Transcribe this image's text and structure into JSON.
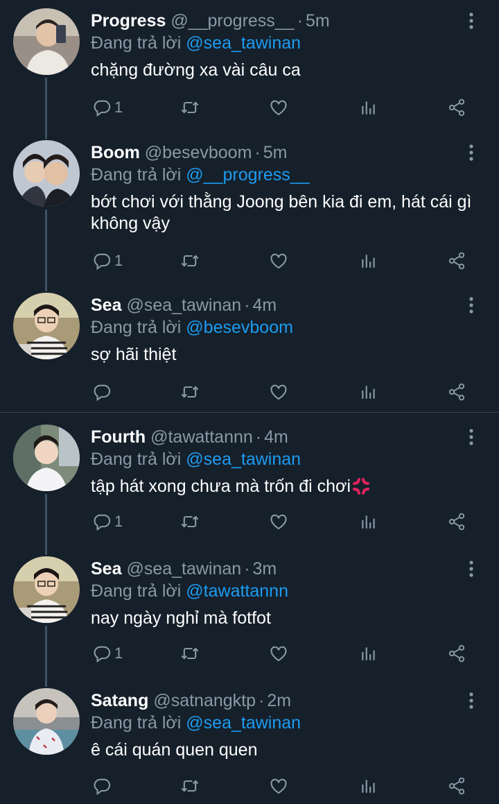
{
  "reply_prefix": "Đang trả lời",
  "tweets": [
    {
      "name": "Progress",
      "handle": "@__progress__",
      "time": "5m",
      "reply_to": "@sea_tawinan",
      "text": "chặng đường xa vài câu ca",
      "reply_count": "1"
    },
    {
      "name": "Boom",
      "handle": "@besevboom",
      "time": "5m",
      "reply_to": "@__progress__",
      "text": "bớt chơi với thằng Joong bên kia đi em, hát cái gì không vậy",
      "reply_count": "1"
    },
    {
      "name": "Sea",
      "handle": "@sea_tawinan",
      "time": "4m",
      "reply_to": "@besevboom",
      "text": "sợ hãi thiệt",
      "reply_count": ""
    },
    {
      "name": "Fourth",
      "handle": "@tawattannn",
      "time": "4m",
      "reply_to": "@sea_tawinan",
      "text": "tập hát xong chưa mà trốn đi chơi",
      "reply_count": "1"
    },
    {
      "name": "Sea",
      "handle": "@sea_tawinan",
      "time": "3m",
      "reply_to": "@tawattannn",
      "text": "nay ngày nghỉ mà fotfot",
      "reply_count": "1"
    },
    {
      "name": "Satang",
      "handle": "@satnangktp",
      "time": "2m",
      "reply_to": "@sea_tawinan",
      "text": "ê cái quán quen quen",
      "reply_count": ""
    }
  ],
  "icons": {
    "reply": "reply-icon",
    "retweet": "retweet-icon",
    "like": "heart-icon",
    "views": "analytics-icon",
    "share": "share-icon",
    "more": "more-vertical-icon",
    "emoji": "anger-symbol-emoji"
  },
  "colors": {
    "background": "#15202b",
    "text": "#ffffff",
    "secondary": "#8b98a5",
    "mention": "#1d9bf0",
    "thread_line": "#3d5466",
    "emoji": "#e0245e"
  }
}
